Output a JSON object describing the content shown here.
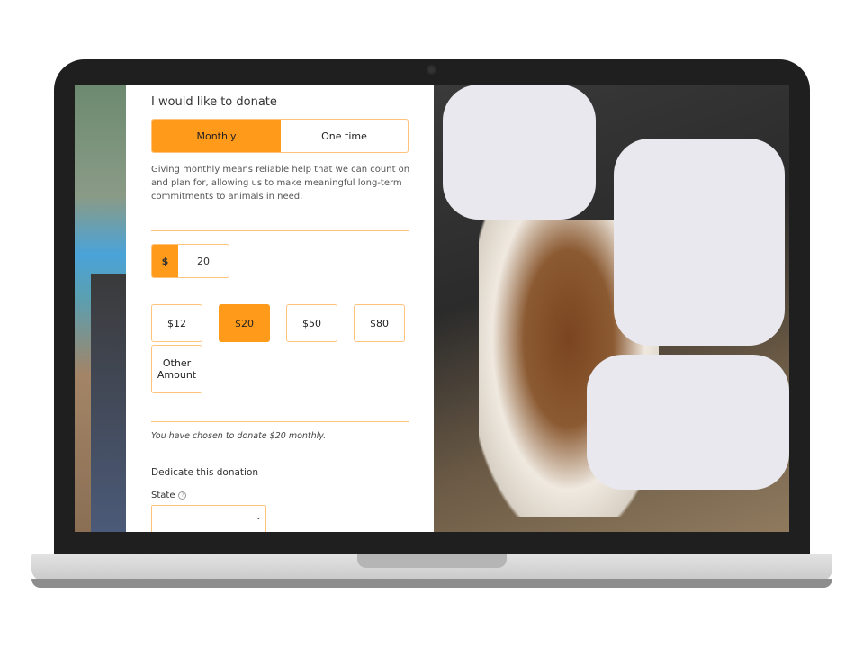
{
  "form": {
    "heading": "I would like to donate",
    "frequency": {
      "options": [
        "Monthly",
        "One time"
      ],
      "selected": "Monthly"
    },
    "description": "Giving monthly means reliable help that we can count on and plan for, allowing us to make meaningful long-term commitments to animals in need.",
    "amount": {
      "currency": "$",
      "value": "20"
    },
    "presets": [
      {
        "label": "$12"
      },
      {
        "label": "$20",
        "selected": true
      },
      {
        "label": "$50"
      },
      {
        "label": "$80"
      },
      {
        "label": "Other Amount"
      }
    ],
    "summary": "You have chosen to donate $20 monthly.",
    "dedicate_label": "Dedicate this donation",
    "state_label": "State",
    "state_value": ""
  },
  "colors": {
    "accent": "#ff9a1a",
    "accent_border": "#ffc37a"
  },
  "icons": {
    "help": "question-circle-icon",
    "dropdown": "chevron-down-icon"
  }
}
